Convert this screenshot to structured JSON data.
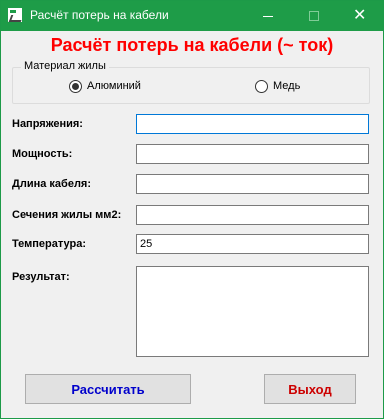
{
  "window": {
    "title": "Расчёт потерь на кабели",
    "minimize_glyph": "—",
    "close_glyph": "✕",
    "accent_color": "#1e9c48"
  },
  "heading": "Расчёт потерь на кабели (~ ток)",
  "material": {
    "legend": "Материал жилы",
    "options": [
      {
        "label": "Алюминий",
        "checked": true
      },
      {
        "label": "Медь",
        "checked": false
      }
    ]
  },
  "fields": {
    "voltage": {
      "label": "Напряжения:",
      "value": ""
    },
    "power": {
      "label": "Мощность:",
      "value": ""
    },
    "length": {
      "label": "Длина кабеля:",
      "value": ""
    },
    "section": {
      "label": "Сечения жилы мм2:",
      "value": ""
    },
    "temperature": {
      "label": "Температура:",
      "value": "25"
    },
    "result": {
      "label": "Результат:",
      "value": ""
    }
  },
  "buttons": {
    "calculate": "Рассчитать",
    "exit": "Выход"
  }
}
